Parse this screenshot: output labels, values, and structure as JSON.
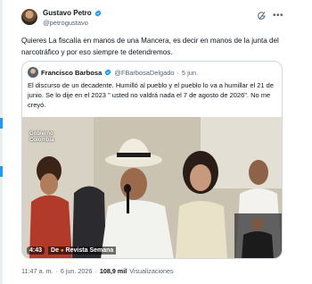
{
  "tweet": {
    "display_name": "Gustavo Petro",
    "handle": "@petrogustavo",
    "text": "Quieres La fiscalía en manos de una Mancera, es decir en manos de la junta del narcotráfico y por eso siempre te detendremos."
  },
  "quoted": {
    "display_name": "Francisco Barbosa",
    "handle": "@FBarbosaDelgado",
    "separator": "·",
    "date": "5 jun.",
    "text": "El discurso de un decadente. Humilló al pueblo y el pueblo lo va a humillar el 21 de junio. Se lo dije en el 2023 \" usted no valdrá nada el 7 de agosto de 2026\". No me creyó.",
    "video": {
      "duration": "4:43",
      "channel_prefix": "De",
      "channel": "Revista Semana",
      "logo_line1": "Gobierno",
      "logo_line2": "Colombia"
    }
  },
  "meta": {
    "time": "11:47 a. m.",
    "date": "6 jun. 2026",
    "views_count": "108,9 mil",
    "views_label": "Visualizaciones",
    "sep": "·"
  },
  "colors": {
    "verified": "#1d9bf0",
    "secondary_text": "#536471",
    "primary_text": "#0f1419",
    "border": "#cfd9de"
  },
  "icons": {
    "verified": "verified-badge-icon",
    "grok": "grok-icon",
    "more": "more-dots-icon"
  }
}
